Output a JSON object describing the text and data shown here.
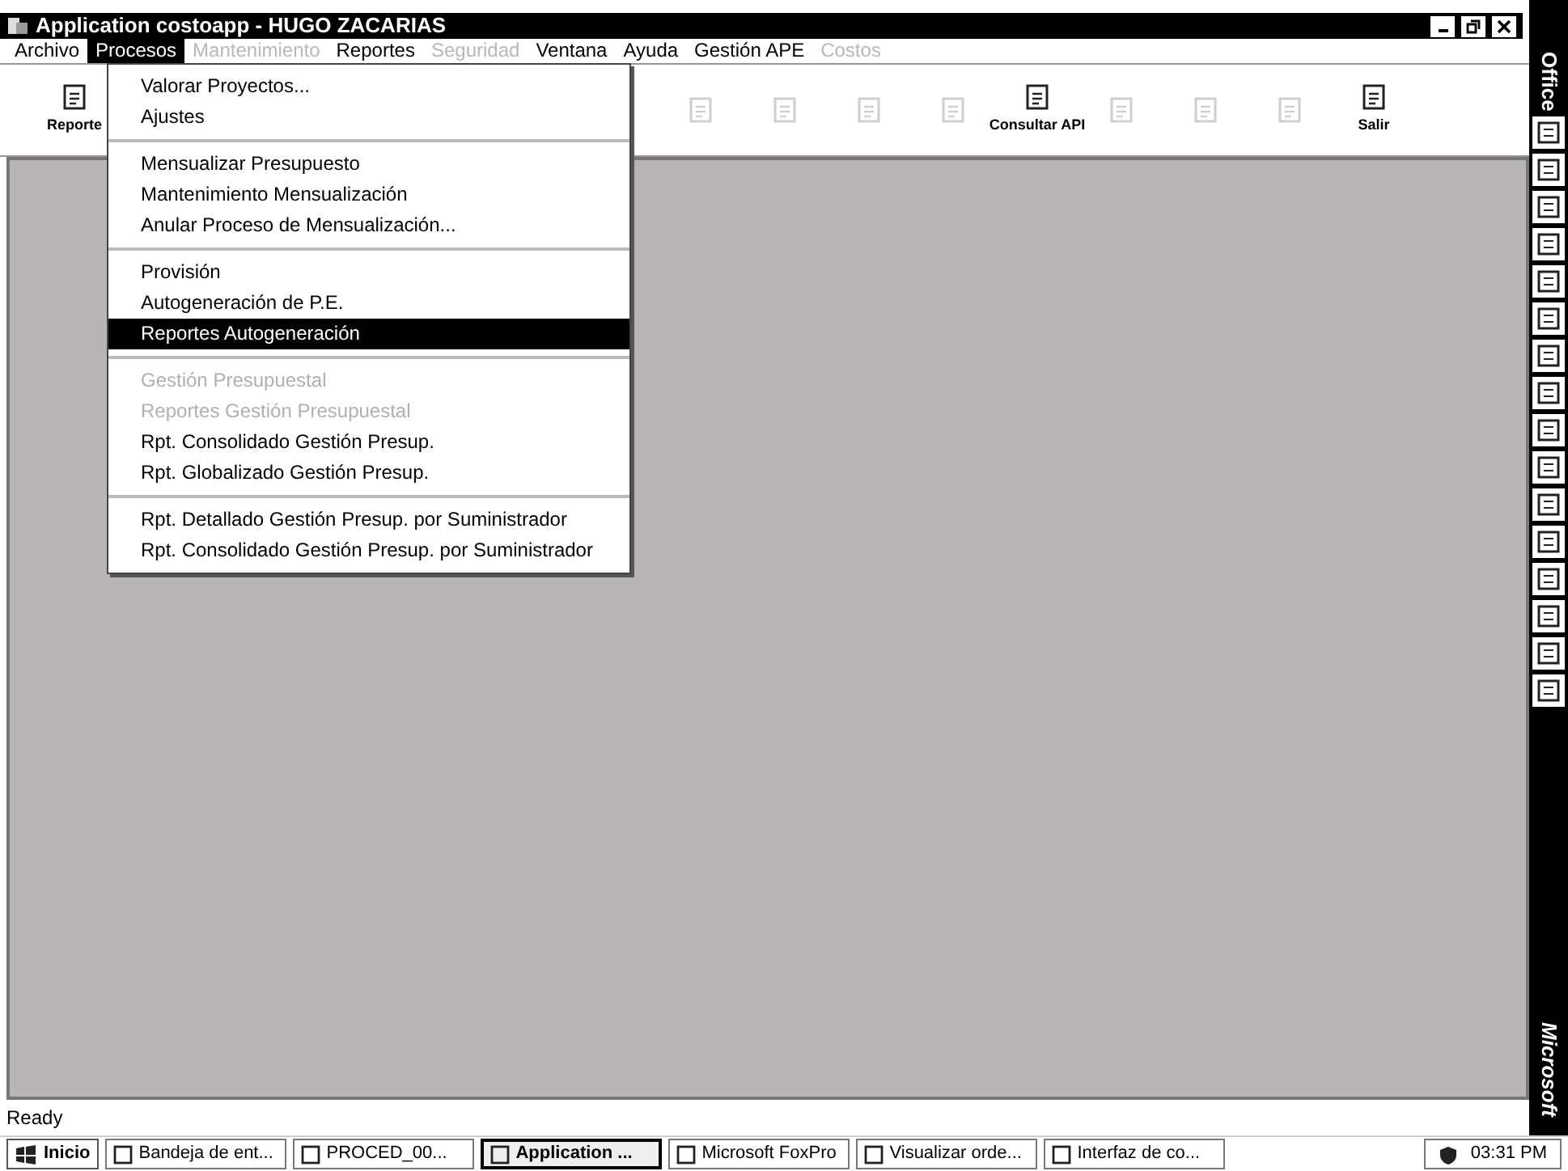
{
  "window": {
    "title": "Application costoapp  -  HUGO ZACARIAS"
  },
  "menu_bar": [
    {
      "label": "Archivo",
      "selected": false,
      "disabled": false
    },
    {
      "label": "Procesos",
      "selected": true,
      "disabled": false
    },
    {
      "label": "Mantenimiento",
      "selected": false,
      "disabled": true
    },
    {
      "label": "Reportes",
      "selected": false,
      "disabled": false
    },
    {
      "label": "Seguridad",
      "selected": false,
      "disabled": true
    },
    {
      "label": "Ventana",
      "selected": false,
      "disabled": false
    },
    {
      "label": "Ayuda",
      "selected": false,
      "disabled": false
    },
    {
      "label": "Gestión APE",
      "selected": false,
      "disabled": false
    },
    {
      "label": "Costos",
      "selected": false,
      "disabled": true
    }
  ],
  "toolbar_left": [
    {
      "label": "Reporte",
      "disabled": false
    }
  ],
  "toolbar_right": [
    {
      "disabled": true
    },
    {
      "disabled": true
    },
    {
      "disabled": true
    },
    {
      "disabled": true
    },
    {
      "label": "Consultar API",
      "disabled": false
    },
    {
      "disabled": true
    },
    {
      "disabled": true
    },
    {
      "disabled": true
    },
    {
      "label": "Salir",
      "disabled": false
    }
  ],
  "dropdown": {
    "groups": [
      [
        {
          "label": "Valorar Proyectos...",
          "selected": false,
          "disabled": false
        },
        {
          "label": "Ajustes",
          "selected": false,
          "disabled": false
        }
      ],
      [
        {
          "label": "Mensualizar Presupuesto",
          "selected": false,
          "disabled": false
        },
        {
          "label": "Mantenimiento Mensualización",
          "selected": false,
          "disabled": false
        },
        {
          "label": "Anular Proceso de Mensualización...",
          "selected": false,
          "disabled": false
        }
      ],
      [
        {
          "label": "Provisión",
          "selected": false,
          "disabled": false
        },
        {
          "label": "Autogeneración de P.E.",
          "selected": false,
          "disabled": false
        },
        {
          "label": "Reportes Autogeneración",
          "selected": true,
          "disabled": false
        }
      ],
      [
        {
          "label": "Gestión Presupuestal",
          "selected": false,
          "disabled": true
        },
        {
          "label": "Reportes Gestión Presupuestal",
          "selected": false,
          "disabled": true
        },
        {
          "label": "Rpt. Consolidado Gestión Presup.",
          "selected": false,
          "disabled": false
        },
        {
          "label": "Rpt. Globalizado Gestión Presup.",
          "selected": false,
          "disabled": false
        }
      ],
      [
        {
          "label": "Rpt. Detallado Gestión Presup. por Suministrador",
          "selected": false,
          "disabled": false
        },
        {
          "label": "Rpt. Consolidado Gestión Presup. por Suministrador",
          "selected": false,
          "disabled": false
        }
      ]
    ]
  },
  "status_bar": {
    "text": "Ready"
  },
  "taskbar": {
    "start": "Inicio",
    "tasks": [
      {
        "label": "Bandeja de ent...",
        "selected": false
      },
      {
        "label": "PROCED_00...",
        "selected": false
      },
      {
        "label": "Application ...",
        "selected": true
      },
      {
        "label": "Microsoft FoxPro",
        "selected": false
      },
      {
        "label": "Visualizar orde...",
        "selected": false
      },
      {
        "label": "Interfaz de co...",
        "selected": false
      }
    ],
    "clock": "03:31 PM"
  },
  "office_bar": {
    "top": "Office",
    "bottom": "Microsoft"
  }
}
